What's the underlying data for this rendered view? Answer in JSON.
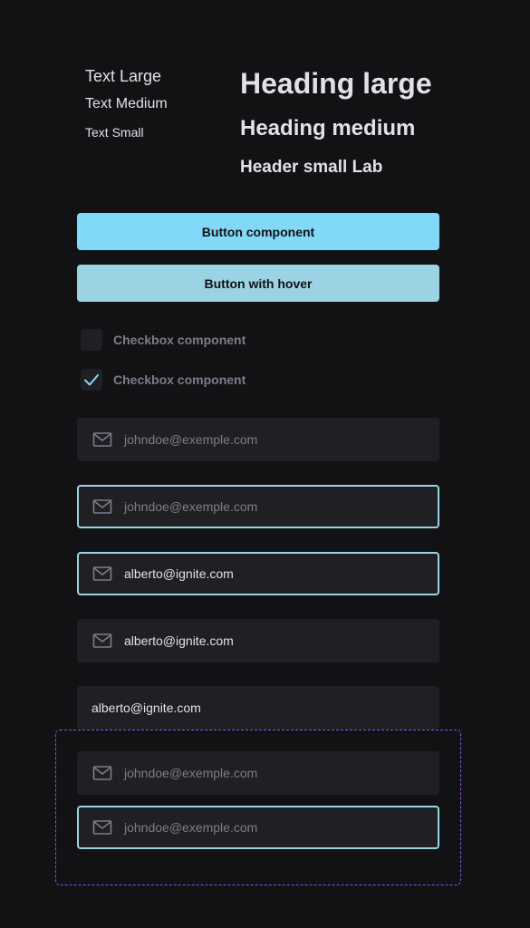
{
  "typography": {
    "text_large": "Text Large",
    "text_medium": "Text Medium",
    "text_small": "Text Small",
    "heading_large": "Heading large",
    "heading_medium": "Heading medium",
    "heading_small": "Header small Lab"
  },
  "buttons": {
    "primary_label": "Button component",
    "hover_label": "Button with hover"
  },
  "checkboxes": [
    {
      "label": "Checkbox component",
      "checked": false
    },
    {
      "label": "Checkbox component",
      "checked": true
    }
  ],
  "inputs": [
    {
      "icon": "envelope-icon",
      "placeholder": "johndoe@exemple.com",
      "value": "",
      "state": "default"
    },
    {
      "icon": "envelope-icon",
      "placeholder": "johndoe@exemple.com",
      "value": "",
      "state": "focus"
    },
    {
      "icon": "envelope-icon",
      "placeholder": "",
      "value": "alberto@ignite.com",
      "state": "focus"
    },
    {
      "icon": "envelope-icon",
      "placeholder": "",
      "value": "alberto@ignite.com",
      "state": "default"
    },
    {
      "icon": "",
      "placeholder": "",
      "value": "alberto@ignite.com",
      "state": "default"
    },
    {
      "icon": "envelope-icon",
      "placeholder": "johndoe@exemple.com",
      "value": "",
      "state": "default"
    },
    {
      "icon": "envelope-icon",
      "placeholder": "johndoe@exemple.com",
      "value": "",
      "state": "focus"
    }
  ],
  "colors": {
    "background": "#121214",
    "surface": "#202024",
    "text_primary": "#e1e1e6",
    "text_muted": "#7c7c8a",
    "accent": "#81d8f7",
    "accent_hover": "#9bd2e4",
    "selection_outline": "#8a55e6"
  }
}
